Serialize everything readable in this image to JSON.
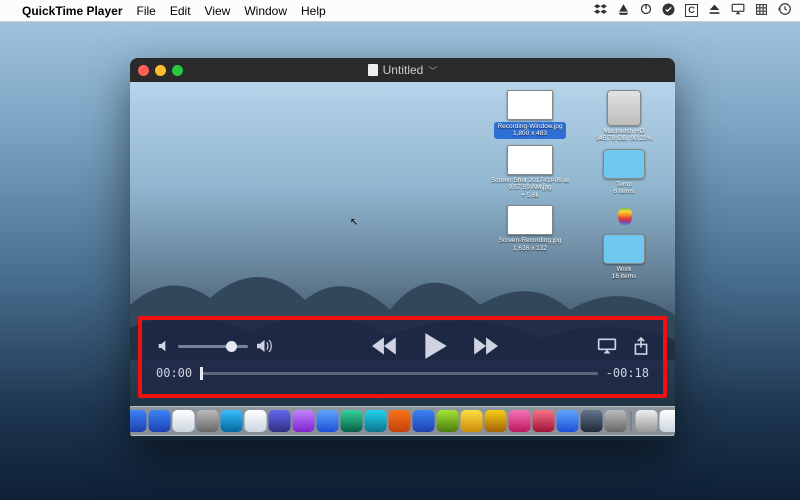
{
  "menubar": {
    "app_name": "QuickTime Player",
    "items": [
      "File",
      "Edit",
      "View",
      "Window",
      "Help"
    ],
    "status_icons": [
      "dropbox-icon",
      "google-drive-icon",
      "power-icon",
      "checkmark-icon",
      "c-square-icon",
      "eject-icon",
      "airplay-icon",
      "grid-icon",
      "time-machine-icon"
    ]
  },
  "window": {
    "title": "Untitled",
    "desktop_files": {
      "left_col": [
        {
          "label": "Recording-Window.jpg",
          "sub": "1,800 x 483",
          "selected": true
        },
        {
          "label": "Screen Shot 2017-03-06 at 9.57.59 AM.jpg",
          "sub": "+ 5.6k"
        },
        {
          "label": "Screen-Recording.jpg",
          "sub": "1,636 x 132"
        }
      ],
      "right_col": [
        {
          "label": "Macintosh HD",
          "sub": "345.78 GB, 90.23%",
          "type": "drive"
        },
        {
          "label": "Temp",
          "sub": "6 items",
          "type": "folder"
        },
        {
          "label": "apple-logo",
          "type": "logo"
        },
        {
          "label": "Work",
          "sub": "16 items",
          "type": "folder"
        }
      ]
    }
  },
  "playback": {
    "elapsed": "00:00",
    "remaining": "-00:18",
    "volume_pct": 70
  },
  "dock": {
    "count": 26
  },
  "highlight_color": "#e11"
}
